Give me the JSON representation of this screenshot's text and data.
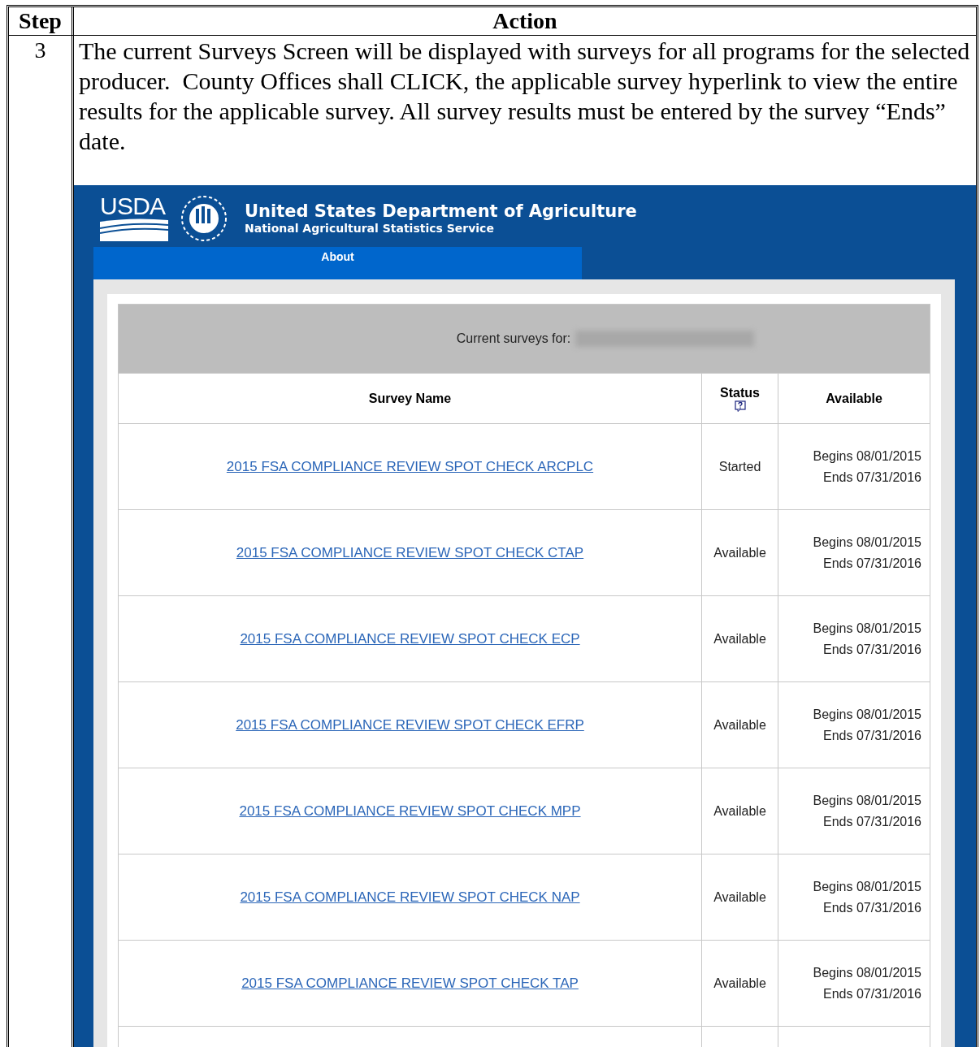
{
  "doc_table": {
    "columns": [
      "Step",
      "Action"
    ],
    "step": "3",
    "paragraph": "The current Surveys Screen will be displayed with surveys for all programs for the selected producer.  County Offices shall CLICK, the applicable survey hyperlink to view the entire results for the applicable survey. All survey results must be entered by the survey “Ends” date."
  },
  "screenshot": {
    "logo_text": "USDA",
    "title": "United States Department of Agriculture",
    "subtitle": "National Agricultural Statistics Service",
    "nav": [
      {
        "label": "About"
      }
    ],
    "current_label": "Current surveys for:",
    "columns": [
      "Survey Name",
      "Status",
      "Available"
    ],
    "rows": [
      {
        "name": "2015 FSA COMPLIANCE REVIEW SPOT CHECK ARCPLC",
        "status": "Started",
        "begins": "Begins 08/01/2015",
        "ends": "Ends 07/31/2016"
      },
      {
        "name": "2015 FSA COMPLIANCE REVIEW SPOT CHECK CTAP",
        "status": "Available",
        "begins": "Begins 08/01/2015",
        "ends": "Ends 07/31/2016"
      },
      {
        "name": "2015 FSA COMPLIANCE REVIEW SPOT CHECK ECP",
        "status": "Available",
        "begins": "Begins 08/01/2015",
        "ends": "Ends 07/31/2016"
      },
      {
        "name": "2015 FSA COMPLIANCE REVIEW SPOT CHECK EFRP",
        "status": "Available",
        "begins": "Begins 08/01/2015",
        "ends": "Ends 07/31/2016"
      },
      {
        "name": "2015 FSA COMPLIANCE REVIEW SPOT CHECK MPP",
        "status": "Available",
        "begins": "Begins 08/01/2015",
        "ends": "Ends 07/31/2016"
      },
      {
        "name": "2015 FSA COMPLIANCE REVIEW SPOT CHECK NAP",
        "status": "Available",
        "begins": "Begins 08/01/2015",
        "ends": "Ends 07/31/2016"
      },
      {
        "name": "2015 FSA COMPLIANCE REVIEW SPOT CHECK TAP",
        "status": "Available",
        "begins": "Begins 08/01/2015",
        "ends": "Ends 07/31/2016"
      }
    ]
  }
}
